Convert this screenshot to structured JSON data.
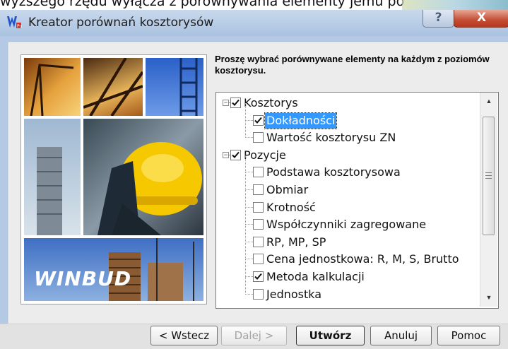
{
  "background_text": "wyższego rzędu wyłącza z porównywania elementy jemu po",
  "window": {
    "title": "Kreator porównań kosztorysów",
    "help_label": "?",
    "close_label": "X"
  },
  "wizard": {
    "brand_text": "WINBUD",
    "prompt": "Proszę wybrać porównywane elementy na każdym z poziomów kosztorysu."
  },
  "tree": {
    "items": [
      {
        "label": "Kosztorys",
        "checked": true,
        "level": 0,
        "expander": "−"
      },
      {
        "label": "Dokładności",
        "checked": true,
        "level": 1,
        "selected": true
      },
      {
        "label": "Wartość kosztorysu ZN",
        "checked": false,
        "level": 1
      },
      {
        "label": "Pozycje",
        "checked": true,
        "level": 0,
        "expander": "−"
      },
      {
        "label": "Podstawa kosztorysowa",
        "checked": false,
        "level": 1
      },
      {
        "label": "Obmiar",
        "checked": false,
        "level": 1
      },
      {
        "label": "Krotność",
        "checked": false,
        "level": 1
      },
      {
        "label": "Współczynniki zagregowane",
        "checked": false,
        "level": 1
      },
      {
        "label": "RP, MP, SP",
        "checked": false,
        "level": 1
      },
      {
        "label": "Cena jednostkowa: R, M, S, Brutto",
        "checked": false,
        "level": 1
      },
      {
        "label": "Metoda kalkulacji",
        "checked": true,
        "level": 1
      },
      {
        "label": "Jednostka",
        "checked": false,
        "level": 1
      }
    ],
    "scroll": {
      "up_glyph": "▲",
      "down_glyph": "▼",
      "position": 0.0
    }
  },
  "buttons": {
    "back": "< Wstecz",
    "next": "Dalej >",
    "create": "Utwórz",
    "cancel": "Anuluj",
    "help": "Pomoc"
  },
  "colors": {
    "title_bar": "#b7cce6",
    "selection": "#3399ff",
    "close_button": "#c44d33"
  }
}
